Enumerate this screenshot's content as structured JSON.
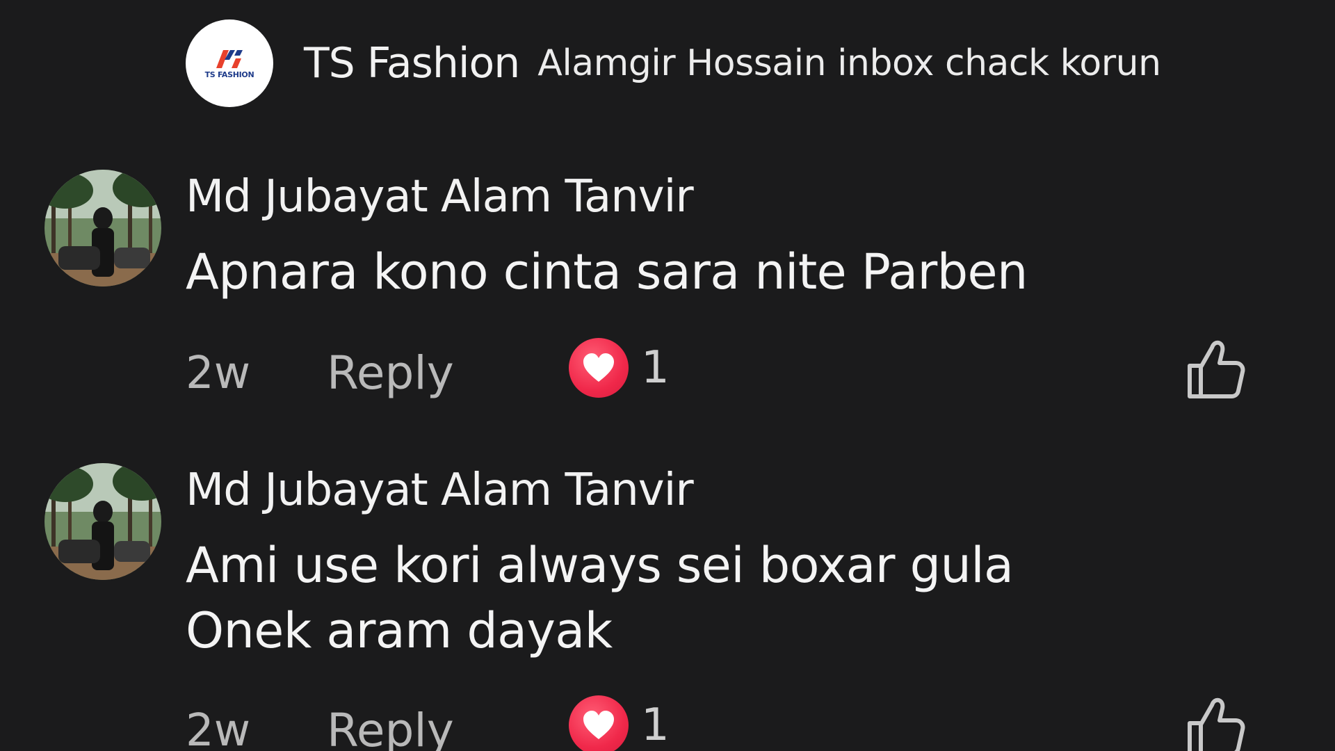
{
  "top_reply": {
    "author": "TS Fashion",
    "text": "Alamgir Hossain inbox chack korun",
    "logo_text": "TS FASHION"
  },
  "comments": [
    {
      "author": "Md Jubayat Alam Tanvir",
      "lines": [
        "Apnara kono cinta sara nite Parben"
      ],
      "time": "2w",
      "reply_label": "Reply",
      "reaction_count": "1"
    },
    {
      "author": "Md Jubayat Alam Tanvir",
      "lines": [
        "Ami use kori always sei boxar gula",
        "Onek aram dayak"
      ],
      "time": "2w",
      "reply_label": "Reply",
      "reaction_count": "1"
    }
  ],
  "icons": {
    "reaction": "heart-icon",
    "like": "thumbs-up-icon"
  },
  "colors": {
    "background": "#1b1b1c",
    "heart": "#f0284a",
    "brand_red": "#e8412c",
    "brand_blue": "#1e3b8a"
  }
}
